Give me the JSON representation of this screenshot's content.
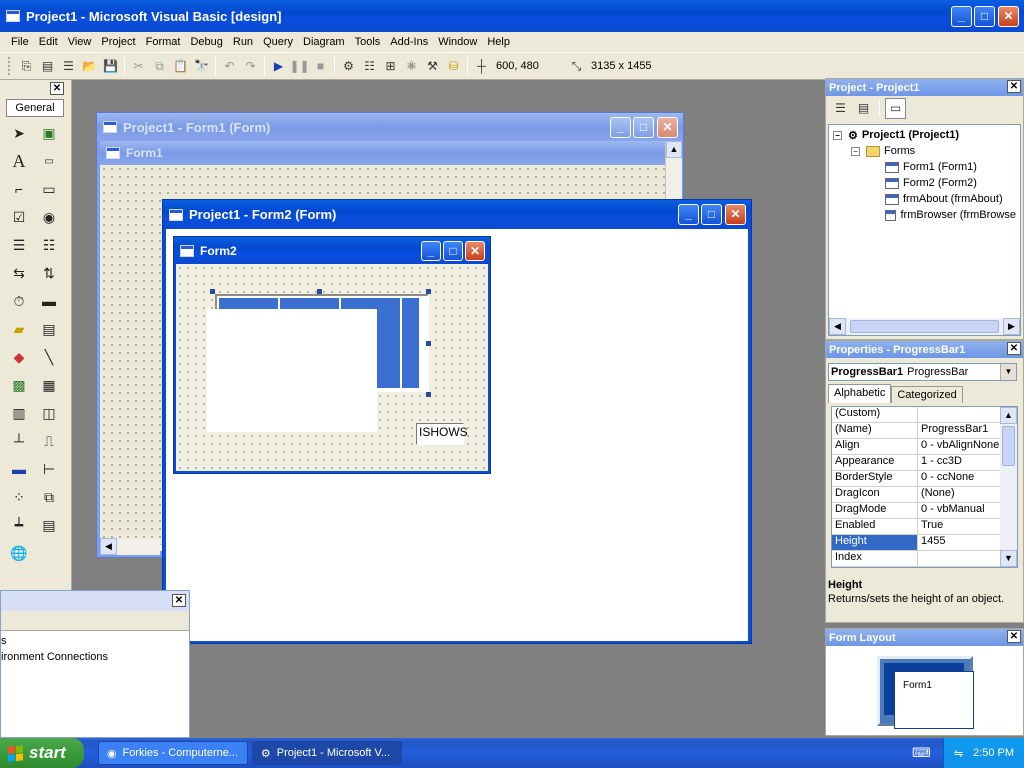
{
  "main_window": {
    "title": "Project1 - Microsoft Visual Basic [design]"
  },
  "menu": [
    "File",
    "Edit",
    "View",
    "Project",
    "Format",
    "Debug",
    "Run",
    "Query",
    "Diagram",
    "Tools",
    "Add-Ins",
    "Window",
    "Help"
  ],
  "toolbar": {
    "position": "600, 480",
    "size": "3135 x 1455"
  },
  "toolbox": {
    "tab_label": "General"
  },
  "form1_window": {
    "title": "Project1 - Form1 (Form)",
    "form_caption": "Form1"
  },
  "form2_window": {
    "title": "Project1 - Form2 (Form)",
    "form_caption": "Form2",
    "label_text": "ISHOWS",
    "progress_value": 1.0
  },
  "project_explorer": {
    "title": "Project - Project1",
    "root": "Project1 (Project1)",
    "folder": "Forms",
    "items": [
      "Form1 (Form1)",
      "Form2 (Form2)",
      "frmAbout (frmAbout)",
      "frmBrowser (frmBrowse"
    ]
  },
  "properties": {
    "title": "Properties - ProgressBar1",
    "object_name": "ProgressBar1",
    "object_type": "ProgressBar",
    "tabs": [
      "Alphabetic",
      "Categorized"
    ],
    "rows": [
      {
        "name": "(Custom)",
        "value": ""
      },
      {
        "name": "(Name)",
        "value": "ProgressBar1"
      },
      {
        "name": "Align",
        "value": "0 - vbAlignNone"
      },
      {
        "name": "Appearance",
        "value": "1 - cc3D"
      },
      {
        "name": "BorderStyle",
        "value": "0 - ccNone"
      },
      {
        "name": "DragIcon",
        "value": "(None)"
      },
      {
        "name": "DragMode",
        "value": "0 - vbManual"
      },
      {
        "name": "Enabled",
        "value": "True"
      },
      {
        "name": "Height",
        "value": "1455"
      },
      {
        "name": "Index",
        "value": ""
      }
    ],
    "selected_row": 8,
    "desc_title": "Height",
    "desc_text": "Returns/sets the height of an object."
  },
  "form_layout": {
    "title": "Form Layout",
    "thumb_label": "Form1"
  },
  "left_pane": {
    "line1": "s",
    "line2": "ironment Connections"
  },
  "taskbar": {
    "start": "start",
    "items": [
      "Forkies - Computerne...",
      "Project1 - Microsoft V..."
    ],
    "clock": "2:50 PM"
  }
}
